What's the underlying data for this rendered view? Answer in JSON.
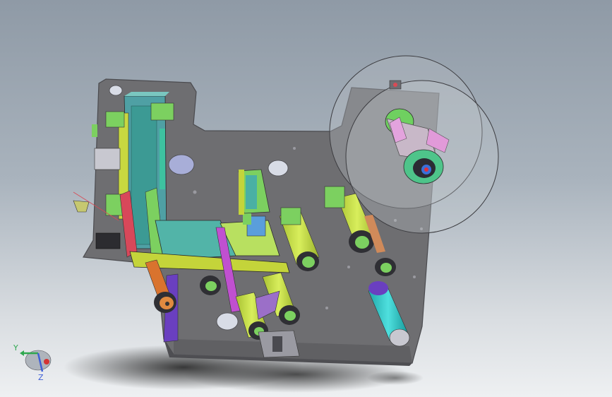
{
  "app": {
    "type": "3D CAD model viewport"
  },
  "triad": {
    "y_label": "Y",
    "z_label": "Z",
    "colors": {
      "y_axis": "#2fa84f",
      "x_axis": "#d43333",
      "z_axis": "#3f5fd6"
    }
  },
  "colors": {
    "background_top": "#8f9aa6",
    "background_bottom": "#eef0f2",
    "plate": "#6f6f72",
    "plate_edge": "#545458",
    "lime_roller": "#c6e04a",
    "cyan_roller": "#35c8c8",
    "teal_block": "#3ea6a0",
    "purple_part": "#6a3fc0",
    "orange_part": "#d9732e",
    "red_part": "#d94a55",
    "pink_part": "#e08cd0"
  }
}
